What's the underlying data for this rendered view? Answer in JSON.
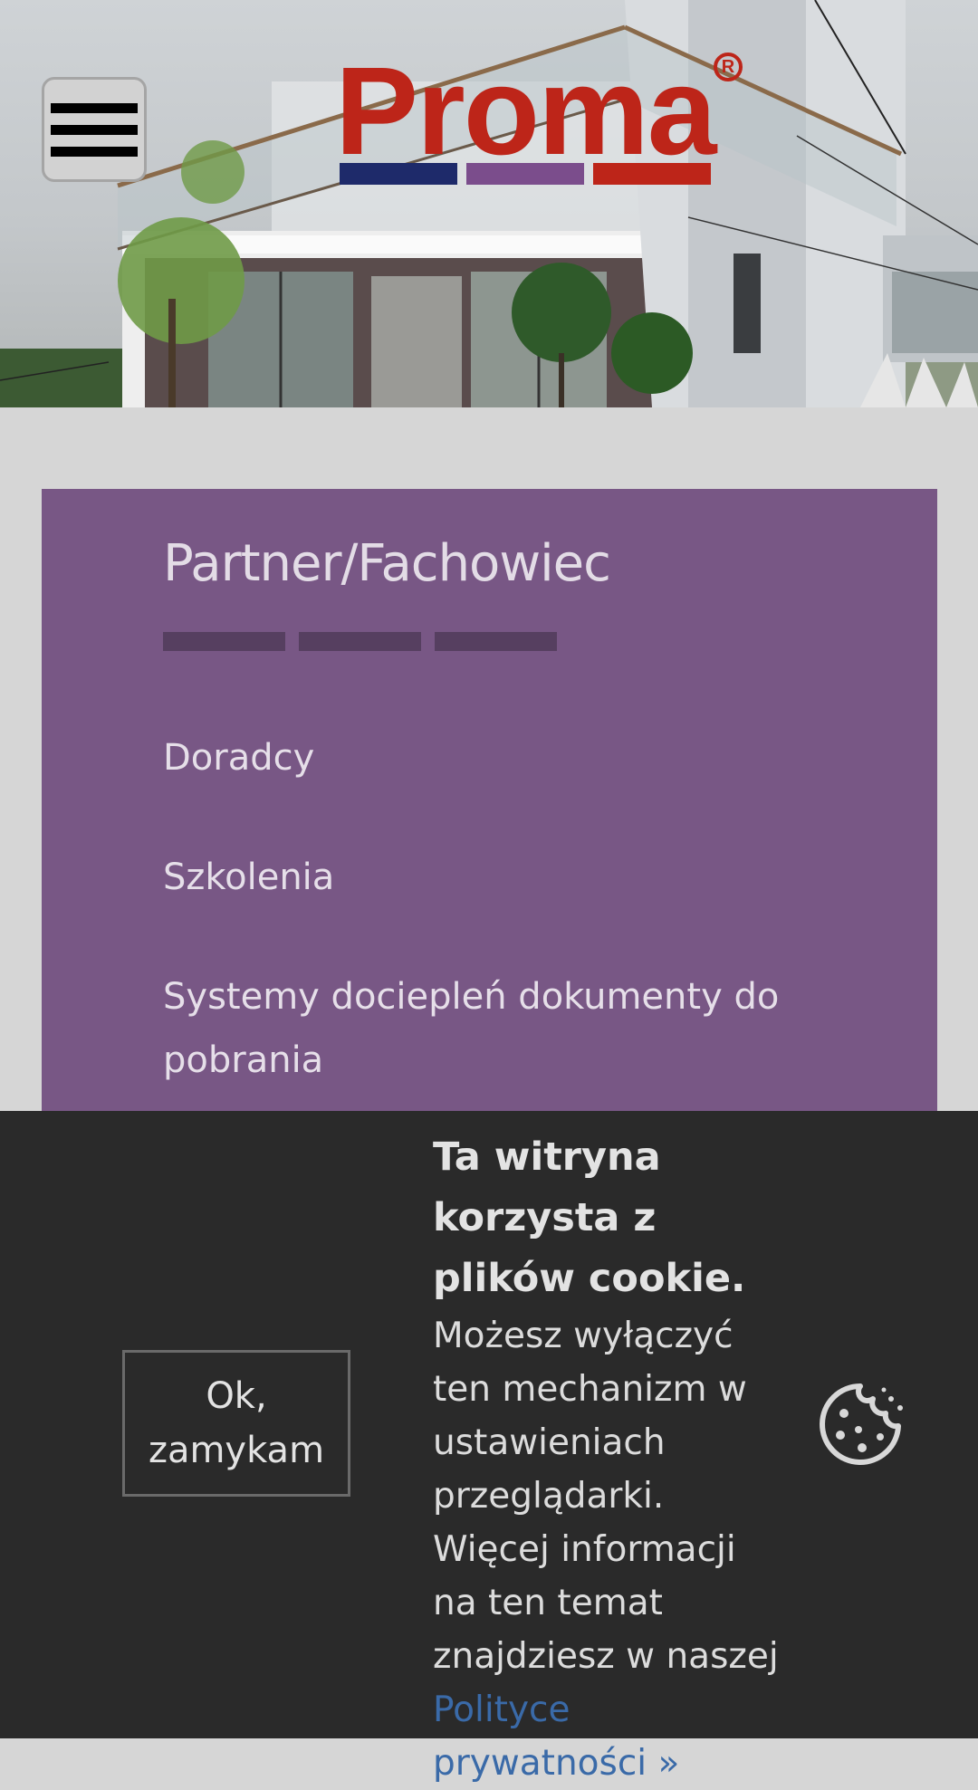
{
  "header": {
    "menu_icon": "hamburger-menu-icon",
    "logo": {
      "text": "Proma",
      "registered": "R",
      "bar_colors": [
        "#1e2a6a",
        "#7b4d8c",
        "#bd2519"
      ]
    }
  },
  "panel": {
    "title": "Partner/Fachowiec",
    "background": "#785785",
    "links": [
      {
        "label": "Doradcy"
      },
      {
        "label": "Szkolenia"
      },
      {
        "label": "Systemy dociepleń dokumenty do pobrania"
      }
    ]
  },
  "cookie_bar": {
    "button_label": "Ok, zamykam",
    "title": "Ta witryna korzysta z plików cookie.",
    "body": "Możesz wyłączyć ten mechanizm w ustawieniach przeglądarki. Więcej informacji na ten temat znajdziesz w naszej ",
    "link_label": "Polityce prywatności »",
    "link_color": "#3a6aa8",
    "icon": "cookie-icon"
  }
}
